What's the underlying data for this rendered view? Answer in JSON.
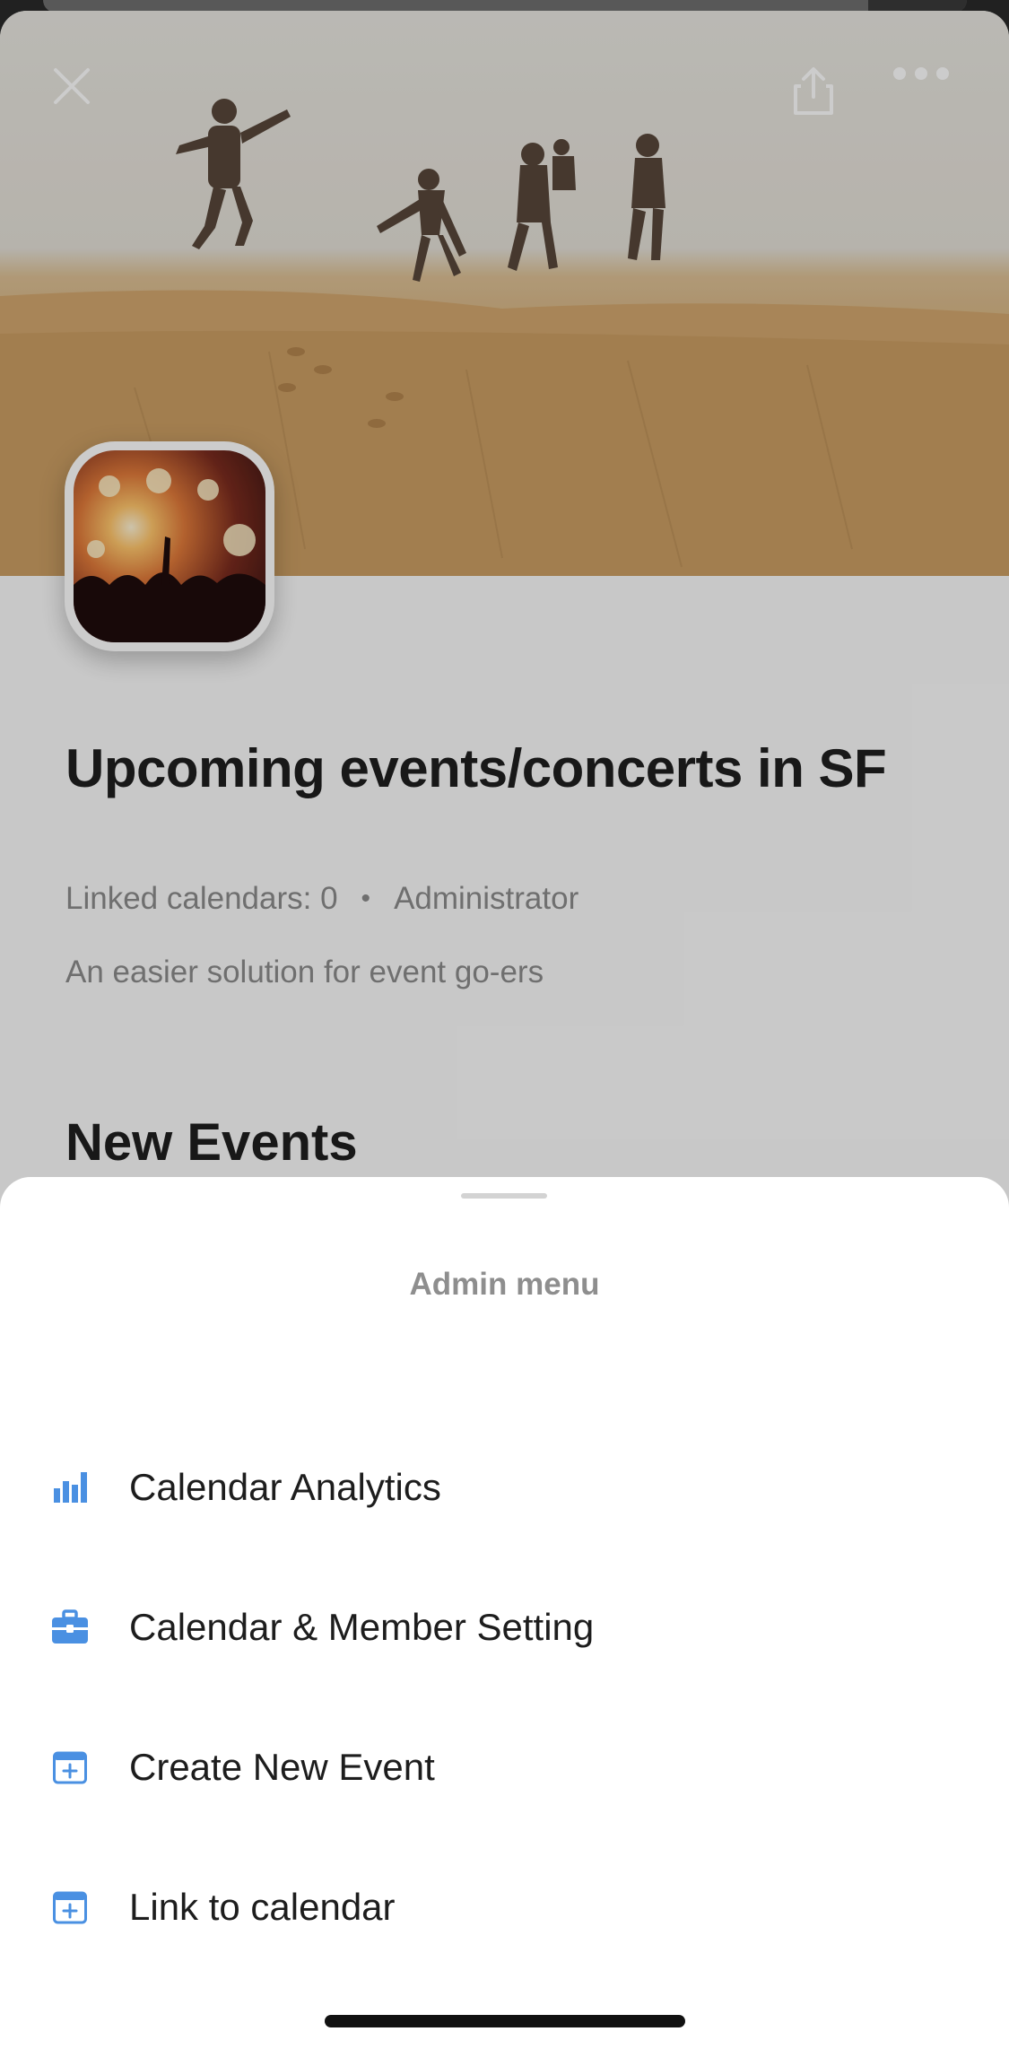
{
  "header": {
    "close_icon": "close-icon",
    "share_icon": "share-icon",
    "more_icon": "more-horizontal-icon"
  },
  "calendar": {
    "title": "Upcoming events/concerts in SF",
    "linked_calendars": "Linked calendars: 0",
    "separator": "•",
    "role": "Administrator",
    "description": "An easier solution for event go-ers"
  },
  "section": {
    "title": "New Events"
  },
  "admin_menu": {
    "title": "Admin menu",
    "accent_color": "#4a90e2",
    "items": [
      {
        "label": "Calendar Analytics",
        "icon": "bar-chart-icon"
      },
      {
        "label": "Calendar & Member Setting",
        "icon": "briefcase-icon"
      },
      {
        "label": "Create New Event",
        "icon": "calendar-plus-icon"
      },
      {
        "label": "Link to calendar",
        "icon": "calendar-plus-icon"
      }
    ]
  }
}
